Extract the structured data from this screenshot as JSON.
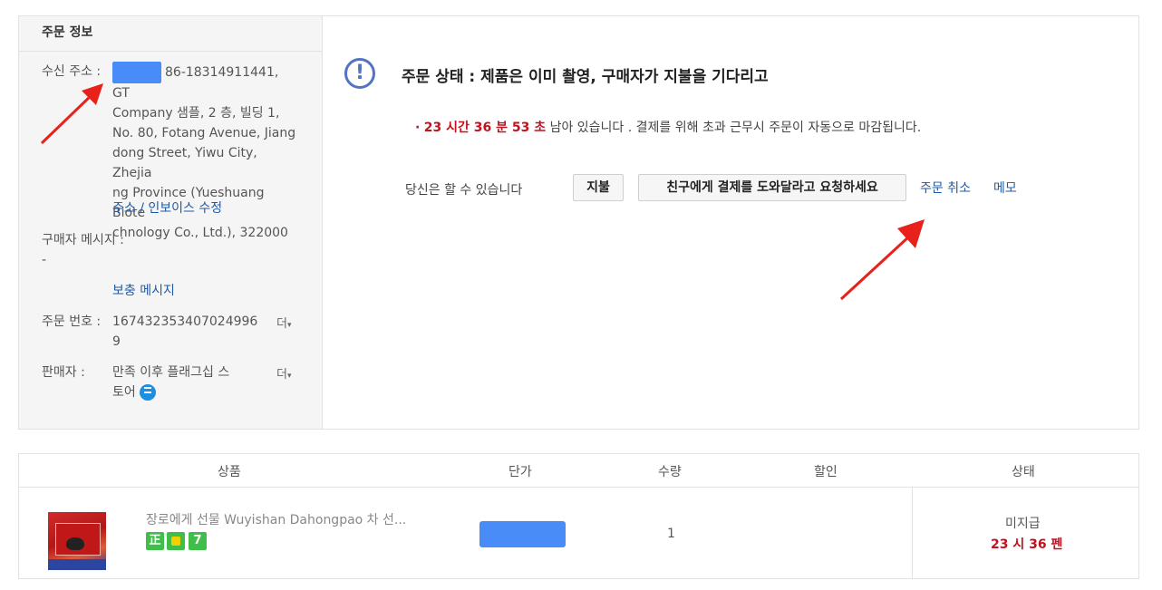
{
  "order_info": {
    "title": "주문 정보",
    "address_label": "수신 주소 :",
    "address_lines": [
      "86-18314911441, GT",
      "Company 샘플, 2 층, 빌딩 1,",
      "No. 80, Fotang Avenue, Jiang",
      "dong Street, Yiwu City, Zhejia",
      "ng Province (Yueshuang Biote",
      "chnology Co., Ltd.), 322000"
    ],
    "edit_address_link": "주소 / 인보이스 수정",
    "buyer_message_label": "구매자 메시지 :",
    "buyer_message_value": "-",
    "supplement_message_link": "보충 메시지",
    "order_number_label": "주문 번호 :",
    "order_number_lines": [
      "167432353407024996",
      "9"
    ],
    "more_label": "더",
    "seller_label": "판매자 :",
    "seller_lines": [
      "만족 이후 플래그십 스",
      "토어"
    ],
    "more_label_2": "더"
  },
  "status": {
    "icon": "exclamation-circle-icon",
    "title": "주문 상태 : 제품은 이미 촬영, 구매자가 지불을 기다리고",
    "bullet": "·",
    "countdown": "23 시간 36 분 53 초",
    "countdown_suffix": "남아 있습니다 . 결제를 위해 초과 근무시 주문이 자동으로 마감됩니다.",
    "actions_label": "당신은 할 수 있습니다",
    "pay_button": "지불",
    "ask_friend_button": "친구에게 결제를 도와달라고 요청하세요",
    "cancel_link": "주문 취소",
    "memo_link": "메모"
  },
  "table": {
    "headers": [
      "상품",
      "단가",
      "수량",
      "할인",
      "상태"
    ],
    "rows": [
      {
        "product_name": "장로에게 선물 Wuyishan Dahongpao 차 선...",
        "badges": [
          "正",
          "7"
        ],
        "quantity": "1",
        "status_text": "미지급",
        "status_countdown": "23 시 36 펜"
      }
    ]
  },
  "colors": {
    "accent_blue": "#1f5aa6",
    "countdown_red": "#c1121f",
    "mask_blue": "#4a8cf7",
    "badge_green": "#3fbf4a",
    "icon_blue": "#5473c6",
    "arrow_red": "#e8221b"
  }
}
